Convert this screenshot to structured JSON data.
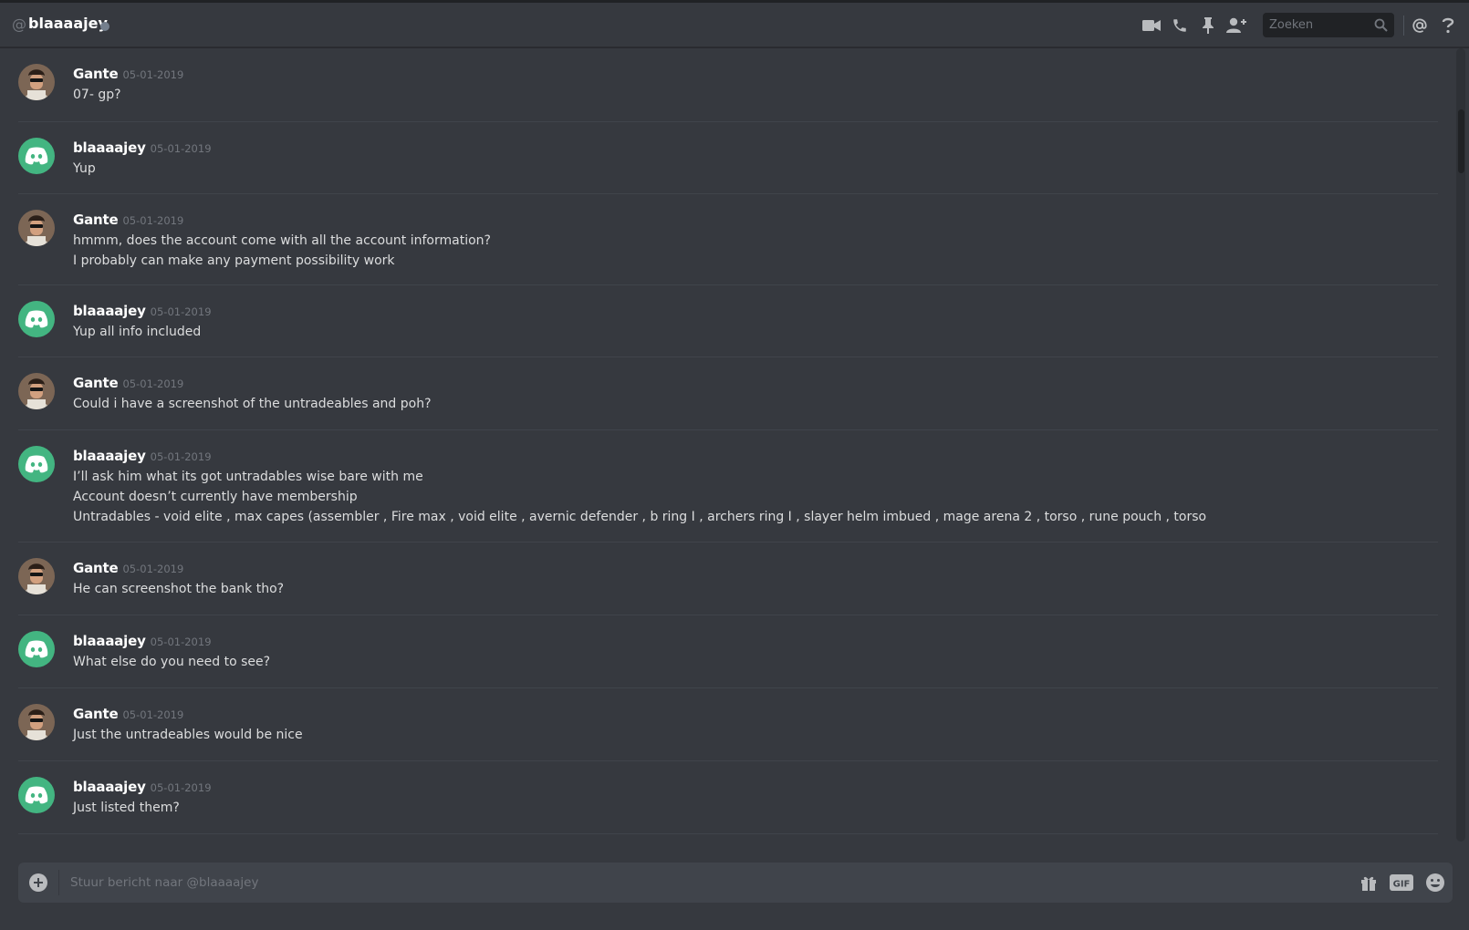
{
  "colors": {
    "background": "#36393f",
    "header_bg": "#36393f",
    "input_bg": "#40444b",
    "search_bg": "#202225",
    "username": "#ffffff",
    "timestamp": "#72767d",
    "message_text": "#dcddde",
    "discord_avatar": "#43b581",
    "status_offline": "#747f8d"
  },
  "header": {
    "at_symbol": "@",
    "username": "blaaaajey",
    "status": "offline",
    "icons": [
      "video-call-icon",
      "voice-call-icon",
      "pinned-messages-icon",
      "add-friend-icon",
      "mention-icon",
      "help-icon"
    ],
    "search_placeholder": "Zoeken"
  },
  "messages": [
    {
      "author": "Gante",
      "avatar": "photo",
      "timestamp": "05-01-2019",
      "lines": [
        "07- gp?"
      ]
    },
    {
      "author": "blaaaajey",
      "avatar": "discord-default",
      "timestamp": "05-01-2019",
      "lines": [
        "Yup"
      ]
    },
    {
      "author": "Gante",
      "avatar": "photo",
      "timestamp": "05-01-2019",
      "lines": [
        "hmmm, does the account come with all the account information?",
        "I probably can make any payment possibility work"
      ]
    },
    {
      "author": "blaaaajey",
      "avatar": "discord-default",
      "timestamp": "05-01-2019",
      "lines": [
        "Yup all info included"
      ]
    },
    {
      "author": "Gante",
      "avatar": "photo",
      "timestamp": "05-01-2019",
      "lines": [
        "Could i have a screenshot of the untradeables and poh?"
      ]
    },
    {
      "author": "blaaaajey",
      "avatar": "discord-default",
      "timestamp": "05-01-2019",
      "lines": [
        "I’ll ask him what its got untradables wise bare with me",
        "Account doesn’t currently have membership",
        "Untradables - void elite , max capes (assembler , Fire max , void elite , avernic defender , b ring I , archers ring I , slayer helm imbued , mage arena 2 , torso , rune pouch , torso"
      ]
    },
    {
      "author": "Gante",
      "avatar": "photo",
      "timestamp": "05-01-2019",
      "lines": [
        "He can screenshot the bank tho?"
      ]
    },
    {
      "author": "blaaaajey",
      "avatar": "discord-default",
      "timestamp": "05-01-2019",
      "lines": [
        "What else do you need to see?"
      ]
    },
    {
      "author": "Gante",
      "avatar": "photo",
      "timestamp": "05-01-2019",
      "lines": [
        "Just the untradeables would be nice"
      ]
    },
    {
      "author": "blaaaajey",
      "avatar": "discord-default",
      "timestamp": "05-01-2019",
      "lines": [
        "Just listed them?"
      ]
    }
  ],
  "composer": {
    "placeholder": "Stuur bericht naar @blaaaajey",
    "icons": [
      "upload-plus-icon",
      "gift-icon",
      "gif-icon",
      "emoji-icon"
    ]
  }
}
